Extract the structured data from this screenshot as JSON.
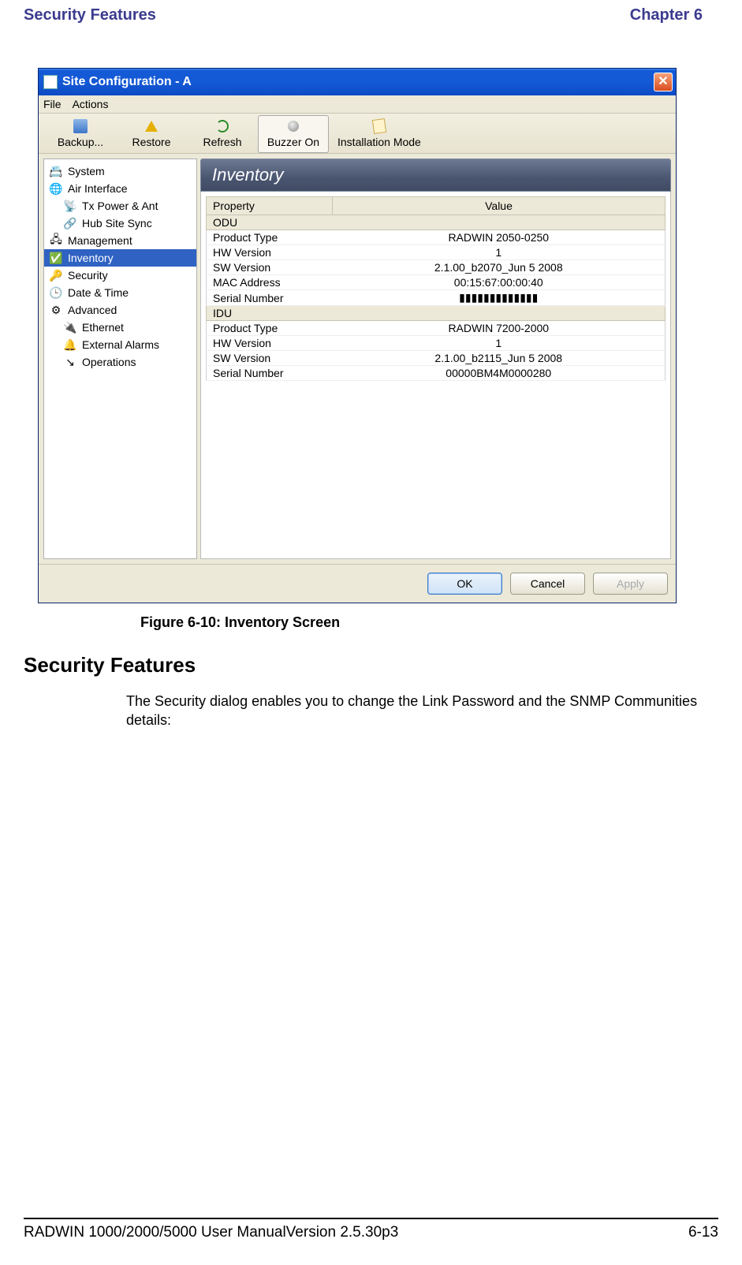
{
  "header": {
    "left": "Security Features",
    "right": "Chapter 6"
  },
  "dialog": {
    "title": "Site Configuration - A",
    "menus": [
      "File",
      "Actions"
    ],
    "toolbar": [
      {
        "label": "Backup...",
        "icon": "disk-icon"
      },
      {
        "label": "Restore",
        "icon": "restore-icon"
      },
      {
        "label": "Refresh",
        "icon": "refresh-icon"
      },
      {
        "label": "Buzzer On",
        "icon": "buzzer-icon",
        "pressed": true
      },
      {
        "label": "Installation Mode",
        "icon": "install-icon"
      }
    ],
    "sidebar": [
      {
        "label": "System",
        "icon": "📇"
      },
      {
        "label": "Air Interface",
        "icon": "🌐"
      },
      {
        "label": "Tx Power & Ant",
        "icon": "📡",
        "child": true
      },
      {
        "label": "Hub Site Sync",
        "icon": "🔗",
        "child": true
      },
      {
        "label": "Management",
        "icon": "🖧"
      },
      {
        "label": "Inventory",
        "icon": "✅",
        "selected": true
      },
      {
        "label": "Security",
        "icon": "🔑"
      },
      {
        "label": "Date & Time",
        "icon": "🕒"
      },
      {
        "label": "Advanced",
        "icon": "⚙"
      },
      {
        "label": "Ethernet",
        "icon": "🔌",
        "child": true
      },
      {
        "label": "External Alarms",
        "icon": "🔔",
        "child": true
      },
      {
        "label": "Operations",
        "icon": "↘",
        "child": true
      }
    ],
    "panel_title": "Inventory",
    "columns": {
      "property": "Property",
      "value": "Value"
    },
    "sections": [
      {
        "name": "ODU",
        "rows": [
          {
            "property": "Product Type",
            "value": "RADWIN 2050-0250"
          },
          {
            "property": "HW Version",
            "value": "1"
          },
          {
            "property": "SW Version",
            "value": "2.1.00_b2070_Jun  5 2008"
          },
          {
            "property": "MAC Address",
            "value": "00:15:67:00:00:40"
          },
          {
            "property": "Serial Number",
            "value": "▮▮▮▮▮▮▮▮▮▮▮▮▮"
          }
        ]
      },
      {
        "name": "IDU",
        "rows": [
          {
            "property": "Product Type",
            "value": "RADWIN 7200-2000"
          },
          {
            "property": "HW Version",
            "value": "1"
          },
          {
            "property": "SW Version",
            "value": "2.1.00_b2115_Jun  5 2008"
          },
          {
            "property": "Serial Number",
            "value": "00000BM4M0000280"
          }
        ]
      }
    ],
    "buttons": {
      "ok": "OK",
      "cancel": "Cancel",
      "apply": "Apply"
    }
  },
  "caption": "Figure 6-10: Inventory Screen",
  "section_heading": "Security Features",
  "paragraph": "The Security dialog enables you to change the Link Password and the SNMP Communities details:",
  "footer": {
    "left": "RADWIN 1000/2000/5000 User ManualVersion  2.5.30p3",
    "right": "6-13"
  }
}
